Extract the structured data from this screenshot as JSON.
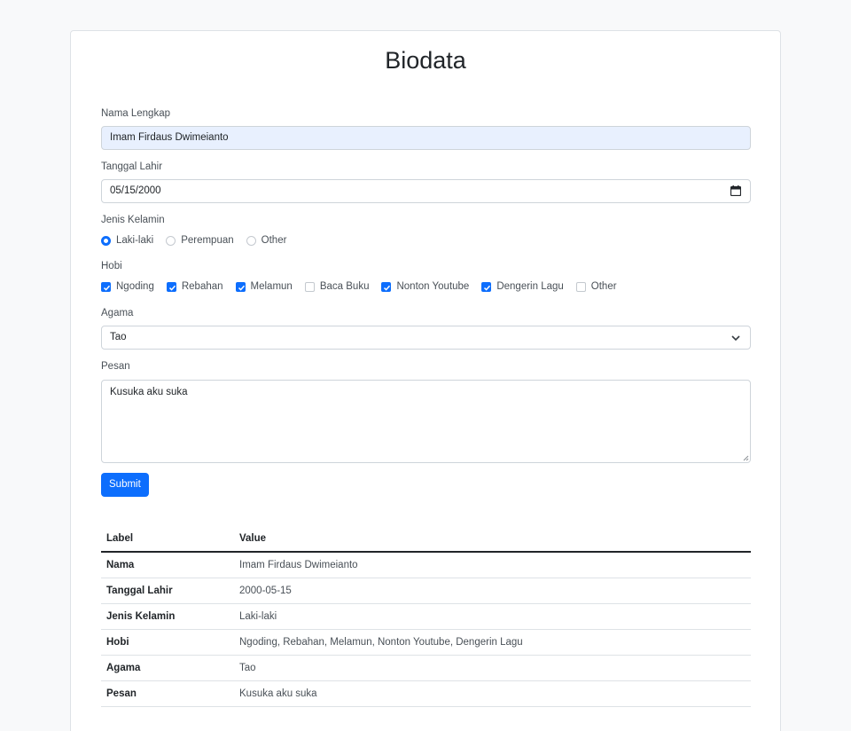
{
  "page": {
    "title": "Biodata"
  },
  "form": {
    "name": {
      "label": "Nama Lengkap",
      "value": "Imam Firdaus Dwimeianto"
    },
    "dob": {
      "label": "Tanggal Lahir",
      "value": "05/15/2000",
      "icon": "calendar-icon"
    },
    "gender": {
      "label": "Jenis Kelamin",
      "options": [
        {
          "label": "Laki-laki",
          "checked": true
        },
        {
          "label": "Perempuan",
          "checked": false
        },
        {
          "label": "Other",
          "checked": false
        }
      ]
    },
    "hobby": {
      "label": "Hobi",
      "options": [
        {
          "label": "Ngoding",
          "checked": true
        },
        {
          "label": "Rebahan",
          "checked": true
        },
        {
          "label": "Melamun",
          "checked": true
        },
        {
          "label": "Baca Buku",
          "checked": false
        },
        {
          "label": "Nonton Youtube",
          "checked": true
        },
        {
          "label": "Dengerin Lagu",
          "checked": true
        },
        {
          "label": "Other",
          "checked": false
        }
      ]
    },
    "religion": {
      "label": "Agama",
      "value": "Tao",
      "icon": "chevron-down-icon"
    },
    "message": {
      "label": "Pesan",
      "value": "Kusuka aku suka"
    },
    "submit_label": "Submit"
  },
  "table": {
    "headers": [
      "Label",
      "Value"
    ],
    "rows": [
      {
        "label": "Nama",
        "value": "Imam Firdaus Dwimeianto"
      },
      {
        "label": "Tanggal Lahir",
        "value": "2000-05-15"
      },
      {
        "label": "Jenis Kelamin",
        "value": "Laki-laki"
      },
      {
        "label": "Hobi",
        "value": "Ngoding, Rebahan, Melamun, Nonton Youtube, Dengerin Lagu"
      },
      {
        "label": "Agama",
        "value": "Tao"
      },
      {
        "label": "Pesan",
        "value": "Kusuka aku suka"
      }
    ]
  },
  "colors": {
    "accent": "#0d6efd",
    "background": "#f8f9fa",
    "autofill": "#e8f0fe"
  }
}
